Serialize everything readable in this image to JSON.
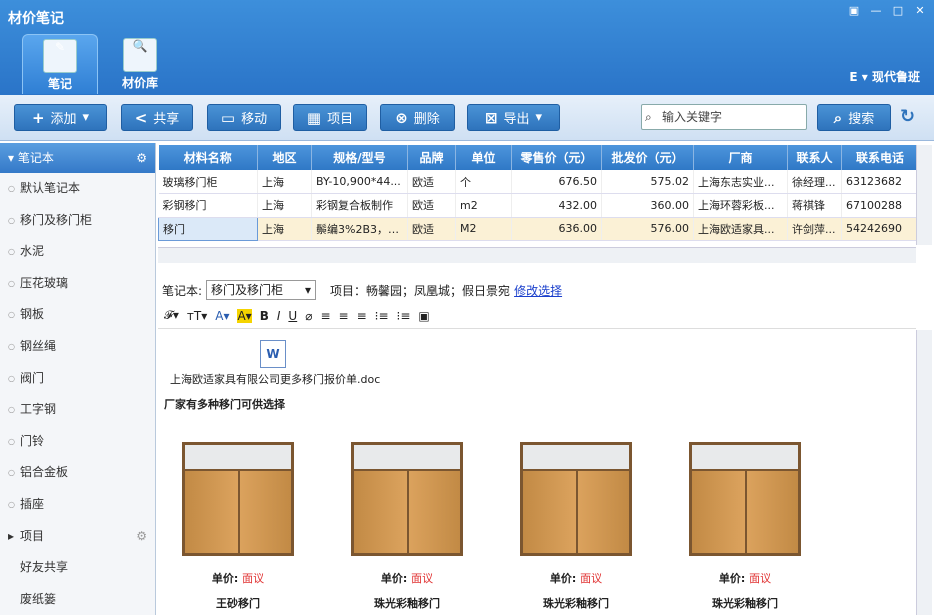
{
  "app": {
    "title": "材价笔记",
    "user": "现代鲁班"
  },
  "nav": [
    {
      "label": "笔记"
    },
    {
      "label": "材价库"
    }
  ],
  "toolbar": {
    "add": "添加",
    "share": "共享",
    "move": "移动",
    "project": "项目",
    "delete": "删除",
    "export": "导出",
    "search_placeholder": "输入关键字",
    "search": "搜索"
  },
  "sidebar": {
    "header": "笔记本",
    "items": [
      "默认笔记本",
      "移门及移门柜",
      "水泥",
      "压花玻璃",
      "钢板",
      "钢丝绳",
      "阀门",
      "工字钢",
      "门铃",
      "铝合金板",
      "插座"
    ],
    "project": "项目",
    "friends": "好友共享",
    "trash": "废纸篓"
  },
  "table": {
    "headers": [
      "材料名称",
      "地区",
      "规格/型号",
      "品牌",
      "单位",
      "零售价（元）",
      "批发价（元）",
      "厂商",
      "联系人",
      "联系电话"
    ],
    "rows": [
      [
        "玻璃移门柜",
        "上海",
        "BY-10,900*44...",
        "欧适",
        "个",
        "676.50",
        "575.02",
        "上海东志实业...",
        "徐经理...",
        "63123682"
      ],
      [
        "彩钢移门",
        "上海",
        "彩钢复合板制作",
        "欧适",
        "m2",
        "432.00",
        "360.00",
        "上海环蓉彩板...",
        "蒋祺锋",
        "67100288"
      ],
      [
        "移门",
        "上海",
        "鬃编3%2B3，1...",
        "欧适",
        "M2",
        "636.00",
        "576.00",
        "上海欧适家具...",
        "许剑萍...",
        "54242690"
      ]
    ]
  },
  "editor": {
    "notebook_label": "笔记本:",
    "notebook_value": "移门及移门柜",
    "project_text": "项目：畅馨园；凤凰城；假日景宛",
    "edit_link": "修改选择",
    "attachment": "上海欧适家具有限公司更多移门报价单.doc",
    "heading": "厂家有多种移门可供选择",
    "products": [
      {
        "price_label": "单价:",
        "price": "面议",
        "name": "王砂移门"
      },
      {
        "price_label": "单价:",
        "price": "面议",
        "name": "珠光彩釉移门"
      },
      {
        "price_label": "单价:",
        "price": "面议",
        "name": "珠光彩釉移门"
      },
      {
        "price_label": "单价:",
        "price": "面议",
        "name": "珠光彩釉移门"
      }
    ]
  }
}
